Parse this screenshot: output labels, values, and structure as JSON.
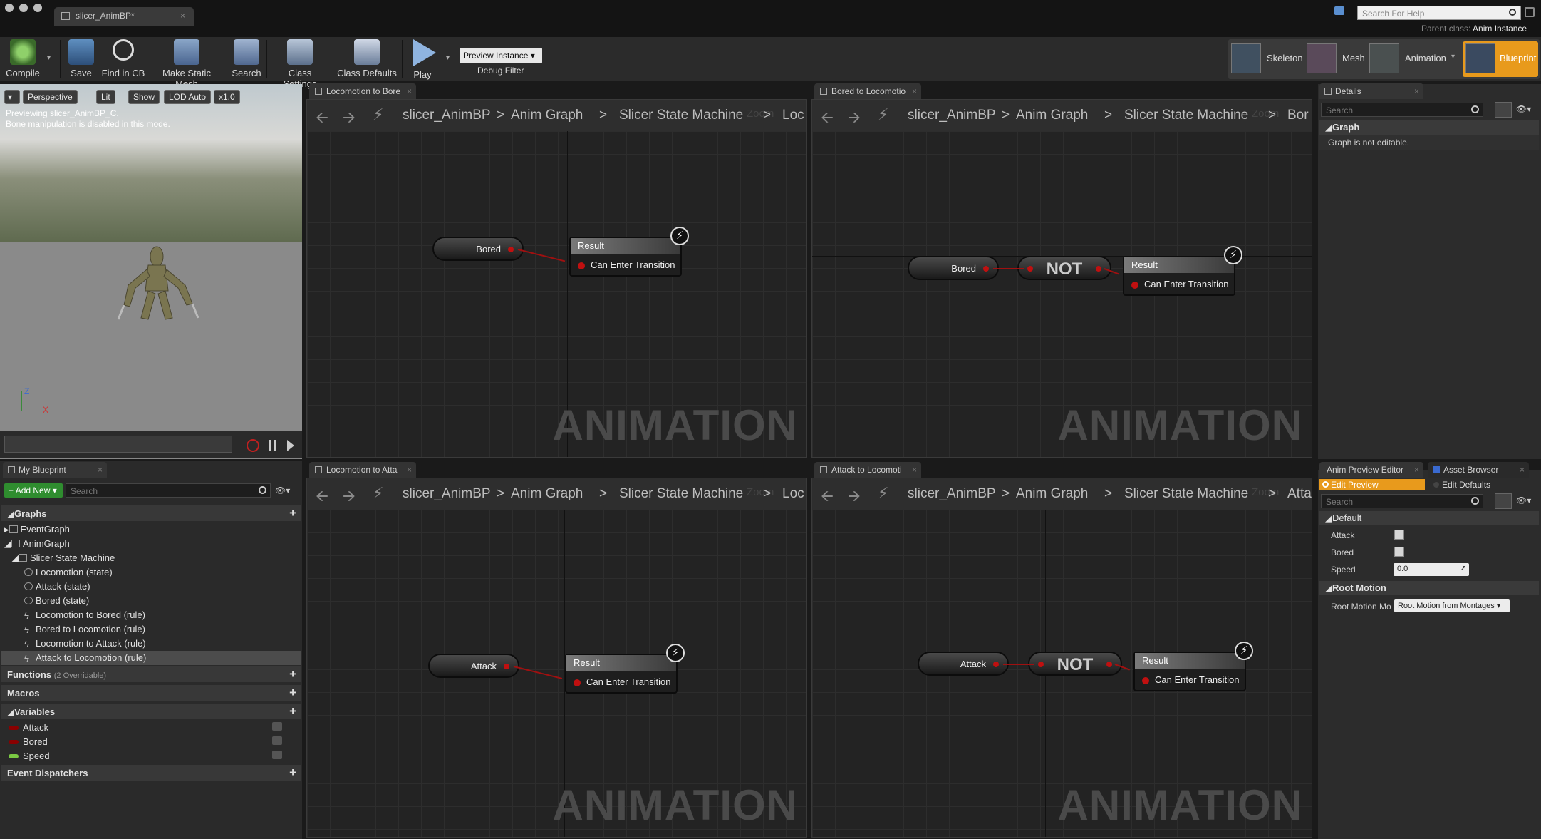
{
  "window": {
    "tab_title": "slicer_AnimBP*",
    "help_placeholder": "Search For Help",
    "parent_label": "Parent class:",
    "parent_value": "Anim Instance"
  },
  "toolbar": {
    "compile": "Compile",
    "save": "Save",
    "find_in_cb": "Find in CB",
    "make_static_mesh": "Make Static Mesh",
    "search": "Search",
    "class_settings": "Class Settings",
    "class_defaults": "Class Defaults",
    "play": "Play",
    "preview_instance": "Preview Instance",
    "debug_filter": "Debug Filter"
  },
  "modes": {
    "skeleton": "Skeleton",
    "mesh": "Mesh",
    "animation": "Animation",
    "blueprint": "Blueprint"
  },
  "viewport": {
    "perspective": "Perspective",
    "lit": "Lit",
    "show": "Show",
    "lod": "LOD Auto",
    "speed": "x1.0",
    "note_line1": "Previewing slicer_AnimBP_C.",
    "note_line2": "Bone manipulation is disabled in this mode.",
    "axis_z": "Z",
    "axis_x": "X"
  },
  "graphs": [
    {
      "tab": "Locomotion to Bore",
      "crumbs": [
        "slicer_AnimBP",
        "Anim Graph",
        "Slicer State Machine",
        "Loc"
      ],
      "zoom": "Zoom",
      "input": "Bored",
      "not": "",
      "result": "Result",
      "output": "Can Enter Transition",
      "watermark": "ANIMATION"
    },
    {
      "tab": "Bored to Locomotio",
      "crumbs": [
        "slicer_AnimBP",
        "Anim Graph",
        "Slicer State Machine",
        "Bor"
      ],
      "zoom": "Zoom",
      "input": "Bored",
      "not": "NOT",
      "result": "Result",
      "output": "Can Enter Transition",
      "watermark": "ANIMATION"
    },
    {
      "tab": "Locomotion to Atta",
      "crumbs": [
        "slicer_AnimBP",
        "Anim Graph",
        "Slicer State Machine",
        "Loc"
      ],
      "zoom": "Zoom",
      "input": "Attack",
      "not": "",
      "result": "Result",
      "output": "Can Enter Transition",
      "watermark": "ANIMATION"
    },
    {
      "tab": "Attack to Locomoti",
      "crumbs": [
        "slicer_AnimBP",
        "Anim Graph",
        "Slicer State Machine",
        "Atta"
      ],
      "zoom": "Zoom",
      "input": "Attack",
      "not": "NOT",
      "result": "Result",
      "output": "Can Enter Transition",
      "watermark": "ANIMATION"
    }
  ],
  "my_blueprint": {
    "tab": "My Blueprint",
    "add_new": "Add New",
    "search_placeholder": "Search",
    "graphs_header": "Graphs",
    "tree": [
      "EventGraph",
      "AnimGraph",
      "Slicer State Machine",
      "Locomotion (state)",
      "Attack (state)",
      "Bored (state)",
      "Locomotion to Bored (rule)",
      "Bored to Locomotion (rule)",
      "Locomotion to Attack (rule)",
      "Attack to Locomotion (rule)"
    ],
    "functions": "Functions",
    "functions_note": "(2 Overridable)",
    "macros": "Macros",
    "variables": "Variables",
    "vars": [
      {
        "name": "Attack",
        "color": "#8a0000"
      },
      {
        "name": "Bored",
        "color": "#8a0000"
      },
      {
        "name": "Speed",
        "color": "#7ac943"
      }
    ],
    "dispatchers": "Event Dispatchers"
  },
  "details": {
    "tab": "Details",
    "search_placeholder": "Search",
    "section": "Graph",
    "message": "Graph is not editable."
  },
  "preview": {
    "tab1": "Anim Preview Editor",
    "tab2": "Asset Browser",
    "edit_preview": "Edit Preview",
    "edit_defaults": "Edit Defaults",
    "search_placeholder": "Search",
    "default_section": "Default",
    "attack": "Attack",
    "bored": "Bored",
    "speed": "Speed",
    "speed_value": "0.0",
    "root_section": "Root Motion",
    "root_label": "Root Motion Mo",
    "root_value": "Root Motion from Montages"
  },
  "colors": {
    "accent_orange": "#f0a020",
    "pin_red": "#c01010",
    "add_green": "#2f8d2f"
  }
}
